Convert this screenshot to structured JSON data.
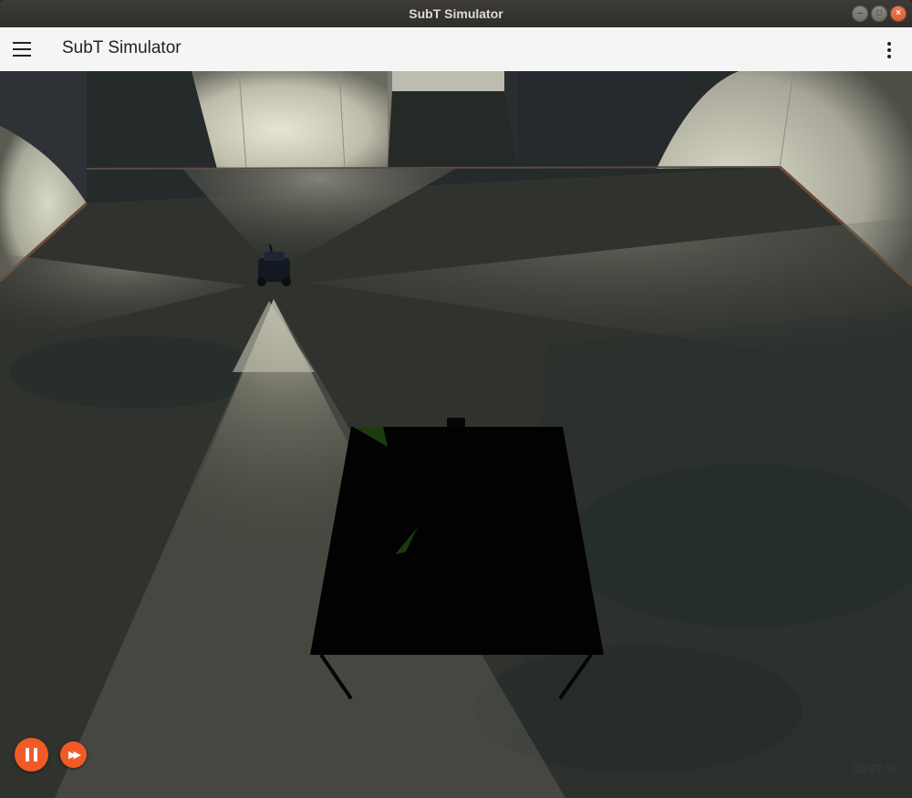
{
  "window": {
    "title": "SubT Simulator",
    "buttons": {
      "minimize": "–",
      "maximize": "□",
      "close": "×"
    }
  },
  "toolbar": {
    "title": "SubT Simulator"
  },
  "icons": {
    "menu": "hamburger-menu-icon",
    "more": "kebab-vertical-icon",
    "pause": "pause-icon",
    "step": "fast-forward-icon"
  },
  "controls": {
    "step_glyph": "▶▶"
  },
  "status": {
    "real_time_factor": "30.97 %"
  },
  "colors": {
    "accent": "#f15a24",
    "toolbar_bg": "#f5f5f5",
    "titlebar_bg": "#3c3b37"
  }
}
